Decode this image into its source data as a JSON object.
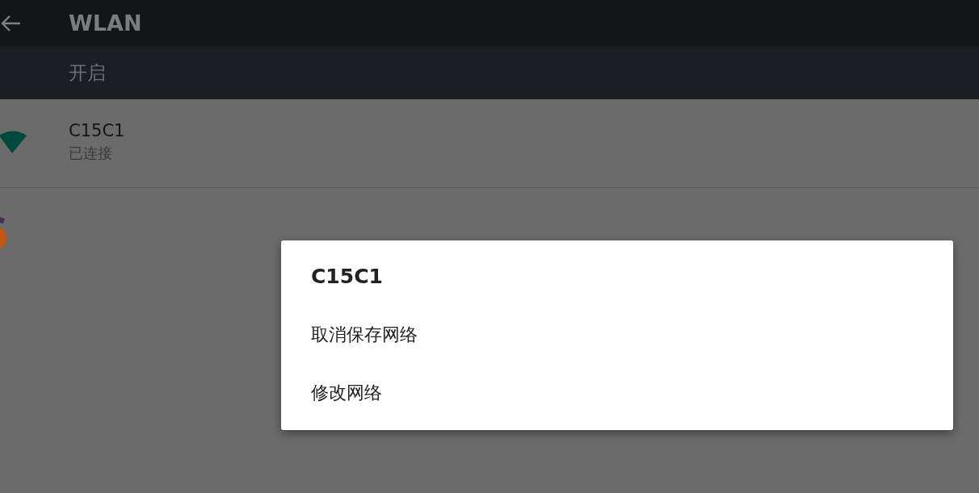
{
  "app_bar": {
    "title": "WLAN"
  },
  "switch_bar": {
    "label": "开启"
  },
  "networks": [
    {
      "ssid": "C15C1",
      "status": "已连接"
    }
  ],
  "dialog": {
    "title": "C15C1",
    "options": [
      "取消保存网络",
      "修改网络"
    ]
  }
}
